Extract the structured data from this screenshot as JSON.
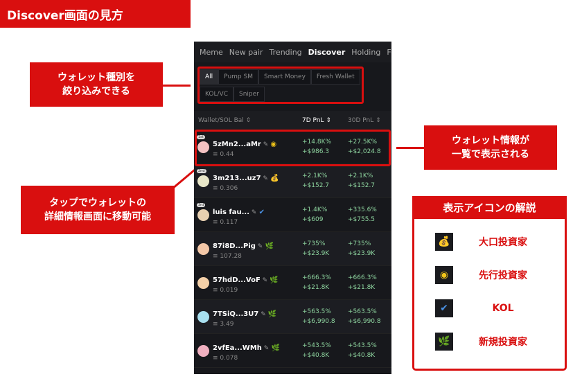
{
  "title": "Discover画面の見方",
  "callouts": {
    "filter": "ウォレット種別を\n絞り込みできる",
    "info": "ウォレット情報が\n一覧で表示される",
    "tap": "タップでウォレットの\n詳細情報画面に移動可能"
  },
  "tabs": [
    "Meme",
    "New pair",
    "Trending",
    "Discover",
    "Holding",
    "Foll"
  ],
  "active_tab": "Discover",
  "filters": [
    "All",
    "Pump SM",
    "Smart Money",
    "Fresh Wallet",
    "KOL/VC",
    "Sniper"
  ],
  "headers": {
    "wallet": "Wallet/SOL Bal ⇕",
    "pnl7": "7D PnL ⇕",
    "pnl30": "30D PnL ⇕"
  },
  "rows": [
    {
      "rank": "1st",
      "name": "5zMn2...aMr",
      "icon": "target-icon",
      "bal": "0.44",
      "p7": "+14.8K%",
      "u7": "+$986.3",
      "p30": "+27.5K%",
      "u30": "+$2,024.8"
    },
    {
      "rank": "2nd",
      "name": "3m213...uz7",
      "icon": "money-bag-icon",
      "bal": "0.306",
      "p7": "+2.1K%",
      "u7": "+$152.7",
      "p30": "+2.1K%",
      "u30": "+$152.7"
    },
    {
      "rank": "3rd",
      "name": "luis fau...",
      "icon": "verified-badge-icon",
      "bal": "0.117",
      "p7": "+1.4K%",
      "u7": "+$609",
      "p30": "+335.6%",
      "u30": "+$755.5"
    },
    {
      "name": "87i8D...Pig",
      "icon": "sprout-icon",
      "bal": "107.28",
      "p7": "+735%",
      "u7": "+$23.9K",
      "p30": "+735%",
      "u30": "+$23.9K"
    },
    {
      "name": "57hdD...VoF",
      "icon": "sprout-icon",
      "bal": "0.019",
      "p7": "+666.3%",
      "u7": "+$21.8K",
      "p30": "+666.3%",
      "u30": "+$21.8K"
    },
    {
      "name": "7TSiQ...3U7",
      "icon": "sprout-icon",
      "bal": "3.49",
      "p7": "+563.5%",
      "u7": "+$6,990.8",
      "p30": "+563.5%",
      "u30": "+$6,990.8"
    },
    {
      "name": "2vfEa...WMh",
      "icon": "sprout-icon",
      "bal": "0.078",
      "p7": "+543.5%",
      "u7": "+$40.8K",
      "p30": "+543.5%",
      "u30": "+$40.8K"
    }
  ],
  "legend": {
    "title": "表示アイコンの解説",
    "items": [
      {
        "icon": "money-bag-icon",
        "label": "大口投資家"
      },
      {
        "icon": "target-icon",
        "label": "先行投資家"
      },
      {
        "icon": "verified-badge-icon",
        "label": "KOL"
      },
      {
        "icon": "sprout-icon",
        "label": "新規投資家"
      }
    ]
  },
  "colors": {
    "accent": "#d90f0f",
    "pnl": "#8fd6a0",
    "bg": "#17181c"
  }
}
